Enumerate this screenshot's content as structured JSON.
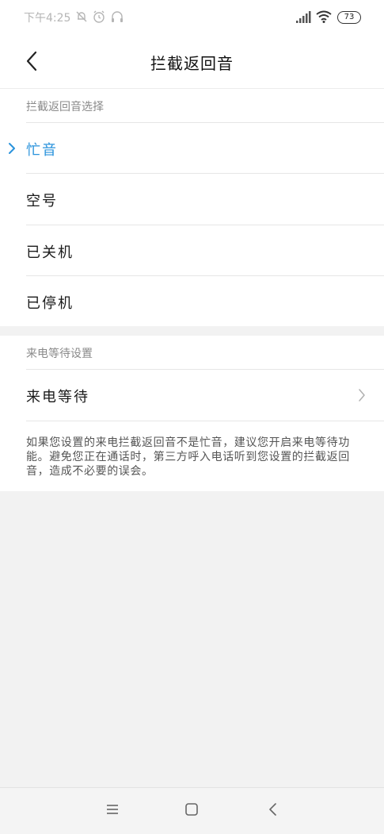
{
  "status_bar": {
    "time": "下午4:25",
    "battery": "73",
    "icons": [
      "mute-bell-icon",
      "alarm-icon",
      "headphones-icon",
      "signal-icon",
      "wifi-icon",
      "battery-icon"
    ]
  },
  "header": {
    "title": "拦截返回音",
    "back_icon": "back-arrow-icon"
  },
  "tone_section": {
    "label": "拦截返回音选择",
    "options": [
      {
        "label": "忙音",
        "selected": true
      },
      {
        "label": "空号",
        "selected": false
      },
      {
        "label": "已关机",
        "selected": false
      },
      {
        "label": "已停机",
        "selected": false
      }
    ]
  },
  "waiting_section": {
    "label": "来电等待设置",
    "item_label": "来电等待",
    "note": "如果您设置的来电拦截返回音不是忙音，建议您开启来电等待功能。避免您正在通话时，第三方呼入电话听到您设置的拦截返回音，造成不必要的误会。"
  },
  "colors": {
    "accent": "#2a93dc",
    "background": "#f2f2f2"
  },
  "nav_bar": {
    "icons": [
      "menu-icon",
      "home-icon",
      "back-icon"
    ]
  }
}
